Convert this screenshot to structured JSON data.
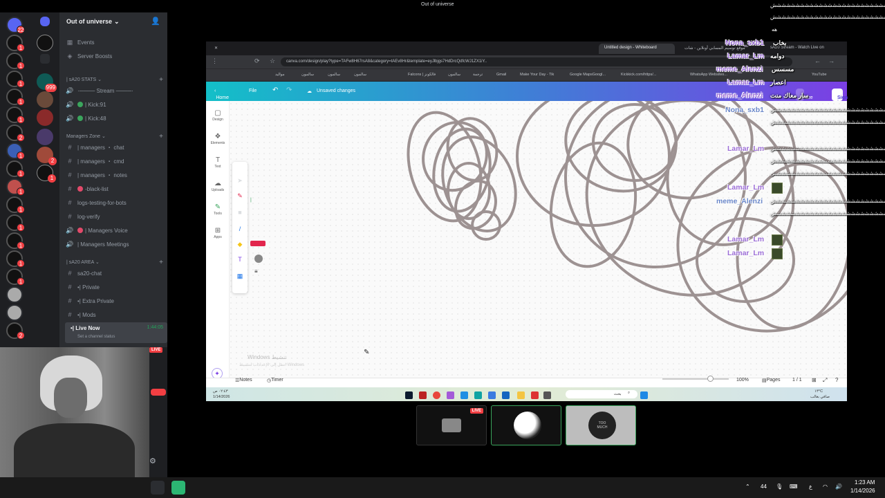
{
  "window": {
    "title": "Out of universe"
  },
  "discord": {
    "server_name": "Out of universe",
    "top_items": [
      {
        "label": "Events",
        "icon": "calendar-icon"
      },
      {
        "label": "Server Boosts",
        "icon": "boost-icon"
      }
    ],
    "categories": [
      {
        "label": "| sA20 STATS ⌄",
        "channels": [
          {
            "label": "·──── Stream ────·",
            "icon": "speaker-icon"
          },
          {
            "label": "| Kick:91",
            "icon": "speaker-icon"
          },
          {
            "label": "| Kick:48",
            "icon": "speaker-icon"
          }
        ]
      },
      {
        "label": "Managers Zone ⌄",
        "channels": [
          {
            "label": "| managers ・ chat",
            "icon": "hash-icon"
          },
          {
            "label": "| managers ・ cmd",
            "icon": "hash-icon"
          },
          {
            "label": "| managers ・ notes",
            "icon": "hash-icon"
          },
          {
            "label": "-black-list",
            "icon": "hash-icon"
          },
          {
            "label": "logs-testing-for-bots",
            "icon": "hash-icon"
          },
          {
            "label": "log-verify",
            "icon": "hash-icon"
          },
          {
            "label": "| Managers Voice",
            "icon": "speaker-icon"
          },
          {
            "label": "| Managers Meetings",
            "icon": "speaker-icon"
          }
        ]
      },
      {
        "label": "| sA20 AREA ⌄",
        "channels": [
          {
            "label": "sa20-chat",
            "icon": "hash-icon"
          },
          {
            "label": "•| Private",
            "icon": "hash-icon"
          },
          {
            "label": "•| Extra Private",
            "icon": "hash-icon"
          },
          {
            "label": "•| Mods",
            "icon": "hash-icon"
          }
        ]
      }
    ],
    "live_channel": {
      "label": "•| Live Now",
      "time": "1:44:05",
      "status": "Set a channel status"
    },
    "rail_badges": [
      "22",
      "1",
      "1",
      "1",
      "1",
      "1",
      "2",
      "1",
      "1",
      "1",
      "1",
      "1",
      "1",
      "1",
      "1",
      "2"
    ],
    "rail2_badges": [
      "999",
      "2",
      "1"
    ],
    "cam_live": "LIVE"
  },
  "browser": {
    "tabs": [
      {
        "label": "Untitled design - Whiteboard"
      },
      {
        "label": "موقع توسيم المسابي أونلاين - شات"
      },
      {
        "label": "sA20 Stream - Watch Live on"
      }
    ],
    "url": "canva.com/design/play?type=TAFw8H67rsA8&category=tAEv8Hr&template=eyJlbjgs7HdDrcQdfcWJ1ZX1iY..",
    "bookmarks": [
      "مواليد",
      "سالمون",
      "سالمون",
      "سالمون",
      "Falcons | فالكونز",
      "سالمون",
      "ترجمة",
      "Gmail",
      "Make Your Day - Tik",
      "Google MapsGoogl...",
      "Kickkick.com/https/...",
      "WhatsApp Websites...",
      "YouTube"
    ]
  },
  "canva": {
    "home": "Home",
    "file": "File",
    "unsaved": "Unsaved changes",
    "share": "Share",
    "signin": "Sign in",
    "side_tools": [
      {
        "label": "Design",
        "icon": "design-icon"
      },
      {
        "label": "Elements",
        "icon": "elements-icon"
      },
      {
        "label": "Text",
        "icon": "text-icon"
      },
      {
        "label": "Uploads",
        "icon": "upload-icon"
      },
      {
        "label": "Tools",
        "icon": "pen-icon"
      },
      {
        "label": "Apps",
        "icon": "apps-icon"
      }
    ],
    "notes": "Notes",
    "timer": "Timer",
    "zoom": "100%",
    "pages_label": "Pages",
    "pages": "1 / 1",
    "watermark_title": "Windows تنشيط",
    "watermark_sub": "انتقل إلى الإعدادات لتنشيط Windows",
    "stroke_color": "#9d9292"
  },
  "inner_taskbar": {
    "time": "٠٢:٤٣ ص",
    "date": "1/14/2026",
    "search": "بحث",
    "weather": "١٣°C",
    "weather_sub": "صافي بغالب"
  },
  "chat_overlay": [
    {
      "user": "Nona_sxb1",
      "msg": "بخاب"
    },
    {
      "user": "Lamar_Lm",
      "msg": "دوامه"
    },
    {
      "user": "meme_Alenzi",
      "msg": "مسسس"
    },
    {
      "user": "Lamar_Lm",
      "msg": "اعصار"
    },
    {
      "user": "meme_Alenzi",
      "msg": "سار معاك منت"
    },
    {
      "user": "Nona_sxb1",
      "msg": ""
    },
    {
      "user": "Lamar_Lm",
      "msg": ""
    },
    {
      "user": "Lamar_Lm",
      "msg": ""
    },
    {
      "user": "meme_Alenzi",
      "msg": ""
    },
    {
      "user": "Lamar_Lm",
      "msg": ""
    },
    {
      "user": "Lamar_Lm",
      "msg": ""
    }
  ],
  "chat_spam": "ششششششششششششششششششششششششش",
  "chat_top_right": "هه",
  "stream_thumbs": {
    "live": "LIVE",
    "avatar_text": "TOO MUCH"
  },
  "taskbar": {
    "time": "1:23 AM",
    "date": "1/14/2026",
    "wifi_num": "44",
    "lang": "ع"
  }
}
